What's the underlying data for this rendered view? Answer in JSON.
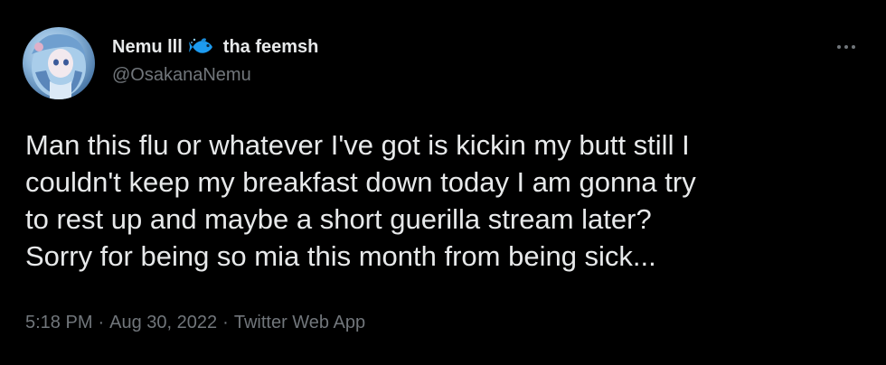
{
  "author": {
    "display_name": "Nemu lll",
    "display_name_suffix": "tha feemsh",
    "emoji_icon": "fish-icon",
    "handle": "@OsakanaNemu"
  },
  "tweet": {
    "text": "Man this flu or whatever I've got is kickin my butt still I\ncouldn't keep my breakfast down today I am gonna try\nto rest up and maybe a short guerilla stream later?\nSorry for being so mia this month from being sick..."
  },
  "meta": {
    "time": "5:18 PM",
    "date": "Aug 30, 2022",
    "source": "Twitter Web App",
    "separator": "·"
  },
  "colors": {
    "background": "#000000",
    "primary_text": "#e7e9ea",
    "secondary_text": "#71767b",
    "fish": "#1d9bf0"
  }
}
